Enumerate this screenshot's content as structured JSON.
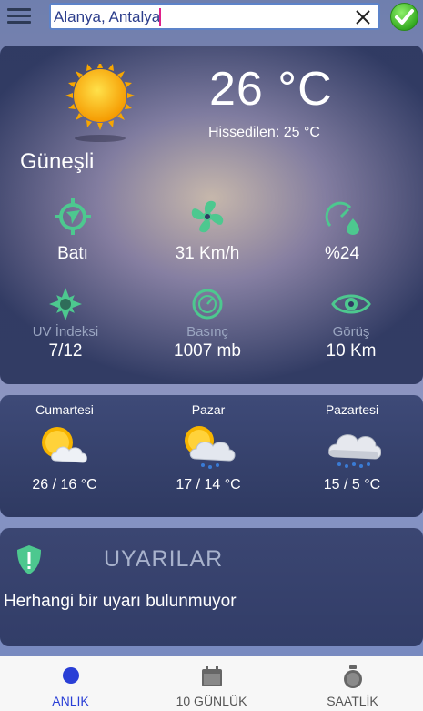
{
  "search": {
    "value": "Alanya, Antalya"
  },
  "current": {
    "temperature": "26 °C",
    "feels_like": "Hissedilen: 25 °C",
    "condition": "Güneşli",
    "icon": "sunny-icon",
    "stats": [
      {
        "icon": "wind-direction-icon",
        "value": "Batı"
      },
      {
        "icon": "fan-icon",
        "value": "31 Km/h"
      },
      {
        "icon": "humidity-gauge-icon",
        "value": "%24"
      },
      {
        "icon": "uv-icon",
        "label": "UV İndeksi",
        "value": "7/12"
      },
      {
        "icon": "pressure-icon",
        "label": "Basınç",
        "value": "1007 mb"
      },
      {
        "icon": "eye-icon",
        "label": "Görüş",
        "value": "10 Km"
      }
    ]
  },
  "forecast": [
    {
      "day": "Cumartesi",
      "icon": "partly-cloudy-icon",
      "temp": "26 / 16 °C"
    },
    {
      "day": "Pazar",
      "icon": "sun-cloud-rain-icon",
      "temp": "17 / 14 °C"
    },
    {
      "day": "Pazartesi",
      "icon": "cloud-rain-icon",
      "temp": "15 / 5 °C"
    }
  ],
  "alerts": {
    "title": "UYARILAR",
    "message": "Herhangi bir uyarı bulunmuyor"
  },
  "nav": [
    {
      "label": "ANLIK",
      "icon": "circle-icon",
      "active": true
    },
    {
      "label": "10 GÜNLÜK",
      "icon": "calendar-icon",
      "active": false
    },
    {
      "label": "SAATLİK",
      "icon": "clock-icon",
      "active": false
    }
  ],
  "colors": {
    "accent": "#2a3fd6",
    "icon_green": "#4dc88f",
    "confirm_green": "#3fbf2a"
  }
}
